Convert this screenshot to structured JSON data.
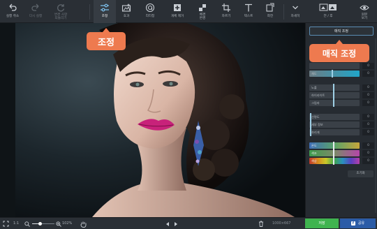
{
  "toolbar": {
    "undo_label": "실행 취소",
    "redo_label": "다시 실행",
    "reset_label_1": "변경 사항",
    "reset_label_2": "되돌리기",
    "adjust_label": "조정",
    "effects_label": "효과",
    "retouch_label": "리터칭",
    "remove_object_label": "개체 제거",
    "replace_bg_label_1": "배경",
    "replace_bg_label_2": "변경",
    "crop_label": "자르기",
    "text_label": "텍스트",
    "rotate_label": "회전",
    "more_label": "자세히",
    "before_after_label": "전 / 후",
    "original_label_1": "원본",
    "original_label_2": "보기"
  },
  "callouts": {
    "adjust": "조정",
    "magic_adjust": "매직 조정"
  },
  "panel": {
    "magic_button": "매직 조정",
    "rows": [
      {
        "label": "",
        "value": "0",
        "fill": 0.0
      },
      {
        "label": "채도",
        "value": "0",
        "fill": 0.45
      },
      {
        "label": "노출",
        "value": "0",
        "fill": 0.48
      },
      {
        "label": "하이라이트",
        "value": "0",
        "fill": 0.48
      },
      {
        "label": "그림자",
        "value": "0",
        "fill": 0.48
      },
      {
        "label": "선명도",
        "value": "0",
        "fill": 0.0
      },
      {
        "label": "세부 정보",
        "value": "0",
        "fill": 0.0
      },
      {
        "label": "흐리게",
        "value": "0",
        "fill": 0.0
      },
      {
        "label": "온도",
        "value": "0",
        "fill": 0.48
      },
      {
        "label": "색조",
        "value": "0",
        "fill": 0.48
      },
      {
        "label": "색상",
        "value": "0",
        "fill": 0.48
      }
    ],
    "reset_button": "초기화"
  },
  "status": {
    "fit_label": "1:1",
    "zoom": "102%",
    "zoom_level": 0.35,
    "image_size": "1000×667",
    "save_label": "저장",
    "share_label": "공유"
  },
  "colors": {
    "accent_callout": "#ee7a4f",
    "save_green": "#3fb44f",
    "share_blue": "#2b5ca7",
    "panel_highlight": "#5b8db3"
  }
}
